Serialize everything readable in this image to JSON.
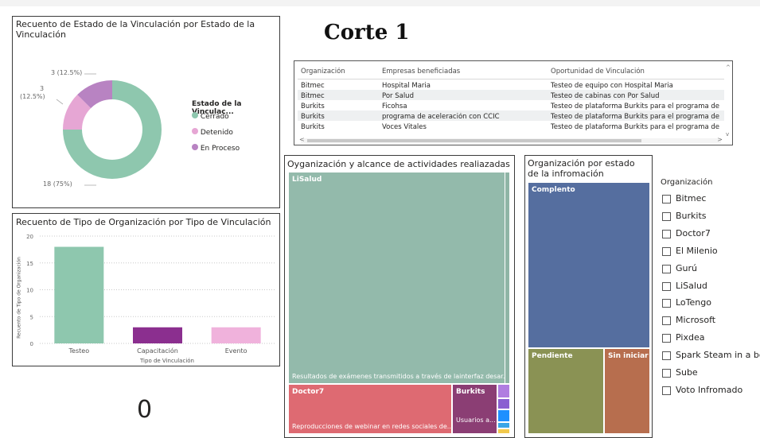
{
  "page_title": "Corte 1",
  "donut": {
    "title": "Recuento de Estado de la Vinculación por Estado de la Vinculación",
    "legend_title": "Estado de la Vinculac...",
    "labels": [
      "3 (12.5%)",
      "3",
      "(12.5%)",
      "18 (75%)"
    ],
    "legend": [
      "Cerrado",
      "Detenido",
      "En Proceso"
    ],
    "colors": [
      "#8ec7ae",
      "#e6a6d4",
      "#b883c2"
    ]
  },
  "table": {
    "headers": [
      "Organización",
      "Empresas beneficiadas",
      "Oportunidad de Vinculación"
    ],
    "rows": [
      [
        "Bitmec",
        "Hospital Maria",
        "Testeo de equipo con Hospital Maria"
      ],
      [
        "Bitmec",
        "Por Salud",
        "Testeo de cabinas con Por Salud"
      ],
      [
        "Burkits",
        "Ficohsa",
        "Testeo de plataforma Burkits para el programa de"
      ],
      [
        "Burkits",
        "programa de aceleración con CCIC",
        "Testeo de plataforma Burkits para el programa de"
      ],
      [
        "Burkits",
        "Voces Vitales",
        "Testeo de plataforma Burkits para el programa de"
      ]
    ]
  },
  "bar": {
    "title": "Recuento de Tipo de Organización por Tipo de Vinculación",
    "ylabel": "Recuento de Tipo de Organización",
    "xlabel": "Tipo de Vinculación"
  },
  "chart_data": {
    "type": "bar",
    "title": "Recuento de Tipo de Organización por Tipo de Vinculación",
    "xlabel": "Tipo de Vinculación",
    "ylabel": "Recuento de Tipo de Organización",
    "categories": [
      "Testeo",
      "Capacitación",
      "Evento"
    ],
    "values": [
      18,
      3,
      3
    ],
    "colors": [
      "#8ec7ae",
      "#8b2f8f",
      "#f0b2dc"
    ],
    "ylim": [
      0,
      20
    ],
    "yticks": [
      "0",
      "5",
      "10",
      "15",
      "20"
    ],
    "grid": true
  },
  "treemap": {
    "title": "Oyganización y alcance de actividades realiazadas",
    "lisalud": "LiSalud",
    "lisalud_sub": "Resultados de exámenes transmitidos a través de lainterfaz desar...",
    "doctor7": "Doctor7",
    "doctor7_sub": "Reproducciones de webinar en redes sociales de...",
    "burkits": "Burkits",
    "burkits_sub": "Usuarios a..."
  },
  "status_tm": {
    "title": "Organización por estado de la infromación",
    "complete": "Complento",
    "pending": "Pendiente",
    "notstarted": "Sin iniciar"
  },
  "slicer": {
    "title": "Organización",
    "items": [
      "Bitmec",
      "Burkits",
      "Doctor7",
      "El Milenio",
      "Gurú",
      "LiSalud",
      "LoTengo",
      "Microsoft",
      "Pixdea",
      "Spark Steam in a bo",
      "Sube",
      "Voto Infromado"
    ]
  },
  "kpi": {
    "value": "0"
  }
}
